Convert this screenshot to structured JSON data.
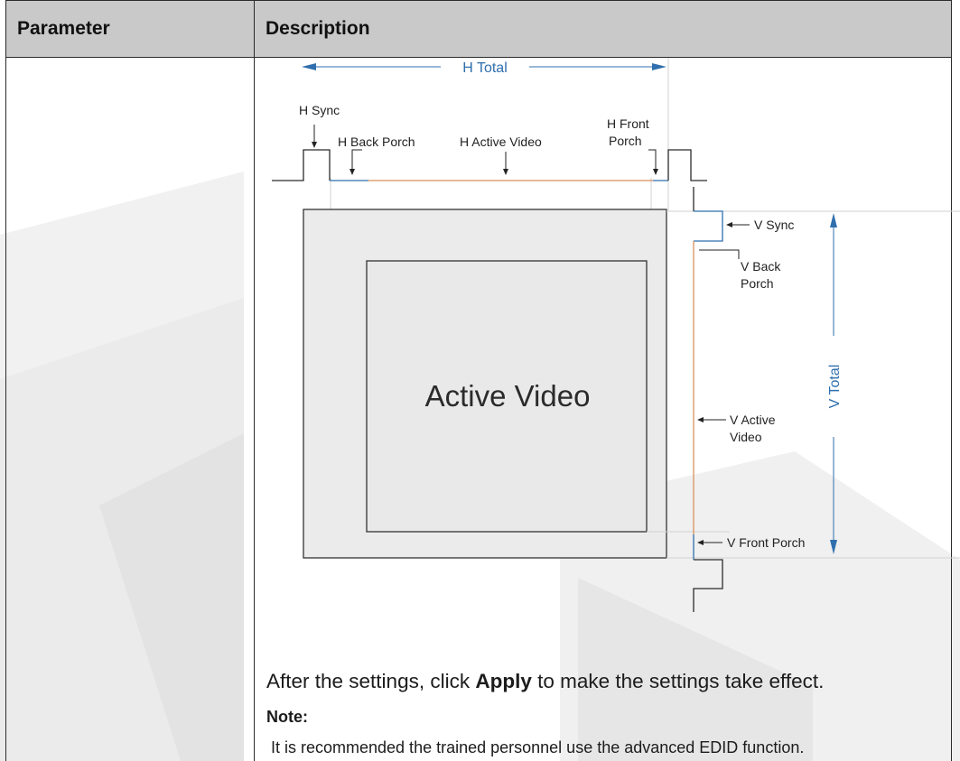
{
  "table": {
    "headers": [
      "Parameter",
      "Description"
    ]
  },
  "diagram": {
    "h_total": "H Total",
    "h_sync": "H Sync",
    "h_back_porch": "H Back Porch",
    "h_active_video": "H Active Video",
    "h_front_porch_line1": "H Front",
    "h_front_porch_line2": "Porch",
    "v_sync": "V Sync",
    "v_back_porch_line1": "V Back",
    "v_back_porch_line2": "Porch",
    "v_total": "V Total",
    "v_active_video_line1": "V Active",
    "v_active_video_line2": "Video",
    "v_front_porch": "V Front Porch",
    "active_video": "Active Video",
    "colors": {
      "blue": "#2f6fae",
      "orange": "#d9905c"
    }
  },
  "body": {
    "apply_before": "After the settings, click ",
    "apply_bold": "Apply",
    "apply_after": " to make the settings take effect.",
    "note_title": "Note:",
    "note_text": "It is recommended the trained personnel use the advanced EDID function."
  }
}
